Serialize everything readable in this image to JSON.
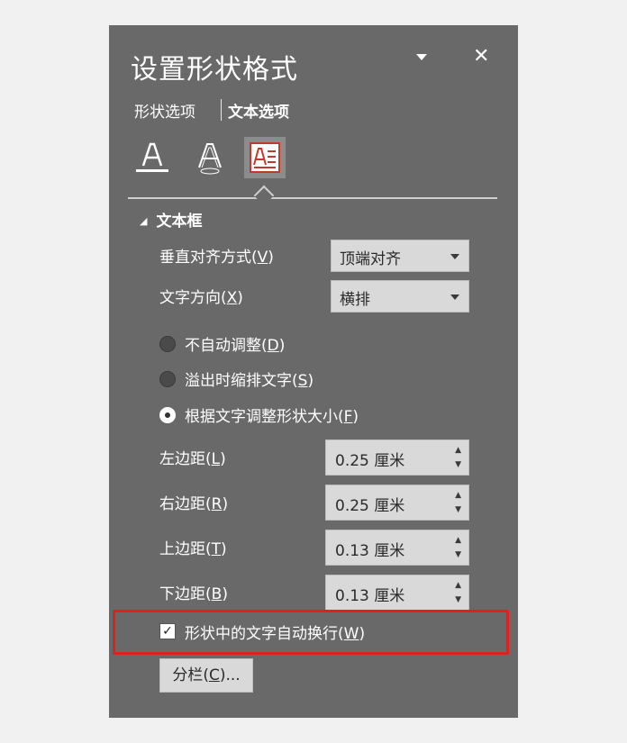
{
  "panel": {
    "title": "设置形状格式",
    "dropdown_icon": "chevron-down-icon",
    "close_icon": "close-icon"
  },
  "tabs": [
    {
      "label": "形状选项",
      "active": false
    },
    {
      "label": "文本选项",
      "active": true
    }
  ],
  "format_icons": [
    "text-fill-outline-icon",
    "text-effects-icon",
    "textbox-icon"
  ],
  "section": {
    "title": "文本框",
    "expanded": true
  },
  "vertical_align": {
    "label": "垂直对齐方式",
    "key": "V",
    "value": "顶端对齐"
  },
  "text_direction": {
    "label": "文字方向",
    "key": "X",
    "value": "横排"
  },
  "autofit": [
    {
      "label": "不自动调整",
      "key": "D",
      "selected": false
    },
    {
      "label": "溢出时缩排文字",
      "key": "S",
      "selected": false
    },
    {
      "label": "根据文字调整形状大小",
      "key": "F",
      "selected": true
    }
  ],
  "margins": [
    {
      "label": "左边距",
      "key": "L",
      "value": "0.25 厘米"
    },
    {
      "label": "右边距",
      "key": "R",
      "value": "0.25 厘米"
    },
    {
      "label": "上边距",
      "key": "T",
      "value": "0.13 厘米"
    },
    {
      "label": "下边距",
      "key": "B",
      "value": "0.13 厘米"
    }
  ],
  "wrap_text": {
    "label": "形状中的文字自动换行",
    "key": "W",
    "checked": true
  },
  "columns_button": {
    "label": "分栏",
    "key": "C",
    "suffix": "..."
  },
  "colors": {
    "panel_bg": "#696969",
    "highlight": "#e02020",
    "accent_icon": "#c0392b"
  }
}
